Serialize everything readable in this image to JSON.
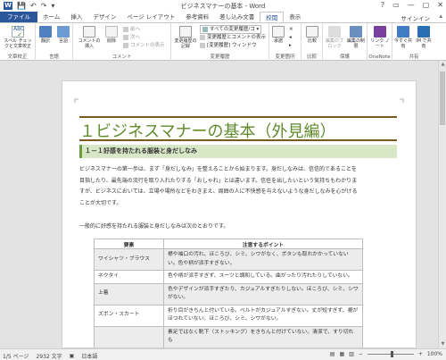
{
  "window": {
    "title": "ビジネスマナーの基本 - Word",
    "controls": [
      "?",
      "▭",
      "—",
      "▢",
      "✕"
    ]
  },
  "qat": {
    "app_logo": "W",
    "save": "💾",
    "undo": "↶",
    "redo": "↷",
    "customize": "▾"
  },
  "tabs": [
    {
      "label": "ファイル"
    },
    {
      "label": "ホーム"
    },
    {
      "label": "挿入"
    },
    {
      "label": "デザイン"
    },
    {
      "label": "ページ レイアウト"
    },
    {
      "label": "参考資料"
    },
    {
      "label": "差し込み文書"
    },
    {
      "label": "校閲"
    },
    {
      "label": "表示"
    }
  ],
  "signin": "サインイン",
  "ribbon": {
    "groups": {
      "proofing": "文章校正",
      "language": "言語",
      "comments": "コメント",
      "tracking": "変更履歴",
      "changes": "変更箇所",
      "compare": "比較",
      "protect": "保護",
      "onenote": "OneNote",
      "share": "共有"
    },
    "buttons": {
      "spelling": "スペル チェックと文章校正",
      "translate": "翻訳",
      "language": "言語",
      "new_comment": "コメントの挿入",
      "delete": "削除",
      "prev": "前へ",
      "next": "次へ",
      "show_comments": "コメントの表示",
      "track_changes": "変更履歴の記録",
      "markup_select": "すべての変更履歴/コ",
      "show_markup": "変更履歴とコメントの表示",
      "review_pane": "[変更履歴] ウィンドウ",
      "accept": "承諾",
      "compare": "比較",
      "block_authors": "編集のブロック",
      "restrict_editing": "編集の制限",
      "linked_notes": "リンク ノート",
      "share_now": "今すぐ共有",
      "im_share": "IM で共有"
    }
  },
  "document": {
    "heading1": "１ビジネスマナーの基本（外見編）",
    "heading2": "１－１好感を持たれる服装と身だしなみ",
    "paragraph_lines": [
      "ビジネスマナーの第一歩は、まず「身だしなみ」を整えることから始まります。身だしなみは、信信的であることを",
      "目指したり、最先端の流行を取り入れたりする「おしゃれ」とは違います。信任を出したいという気持ちもわかりま",
      "すが、ビジネスにおいては、立場や場所などをわきまえ、周囲の人に不快感を与えないような身だしなみを心がける",
      "ことが大切です。"
    ],
    "paragraph2": "一般的に好感を持たれる服装と身だしなみは次のとおりです。",
    "table": {
      "headers": [
        "要素",
        "注意するポイント"
      ],
      "rows": [
        {
          "item": "ワイシャツ・ブラウス",
          "point": "襟や袖口の汚れ、ほころび、シミ、シワがなく、ボタンも取れかかっていないい。色や柄が派手すぎない。"
        },
        {
          "item": "ネクタイ",
          "point": "色や柄が派手すぎず、スーツと調和している。曲がったり汚れたりしていない。"
        },
        {
          "item": "上着",
          "point": "色やデザインが派手すぎたり、カジュアルすぎたりしない。ほころび、シミ、シワがない。"
        },
        {
          "item": "ズボン・スカート",
          "point": "折り目がきちんと付いている。ベルトがカジュアルすぎない。丈が短すぎず、裾がほつれていない。ほころび、シミ、シワがない。"
        },
        {
          "item": "",
          "point": "素足ではなく靴下（ストッキング）をきちんと付けていない。清潔で、すり切れも"
        }
      ]
    }
  },
  "status": {
    "page": "1/5 ページ",
    "words": "2932 文字",
    "language": "日本語",
    "zoom": "100%"
  }
}
